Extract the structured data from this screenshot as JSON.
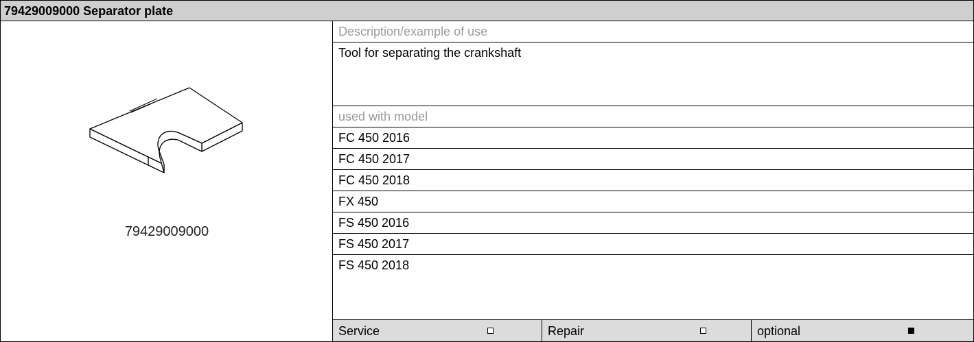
{
  "title": "79429009000 Separator plate",
  "image": {
    "engraving": "79429009000",
    "caption": "79429009000"
  },
  "description_label": "Description/example of use",
  "description": "Tool for separating the crankshaft",
  "used_with_label": "used with model",
  "models": [
    "FC 450 2016",
    "FC 450 2017",
    "FC 450 2018",
    "FX 450",
    "FS 450 2016",
    "FS 450 2017",
    "FS 450 2018"
  ],
  "footer": [
    {
      "label": "Service",
      "checked": false
    },
    {
      "label": "Repair",
      "checked": false
    },
    {
      "label": "optional",
      "checked": true
    }
  ]
}
